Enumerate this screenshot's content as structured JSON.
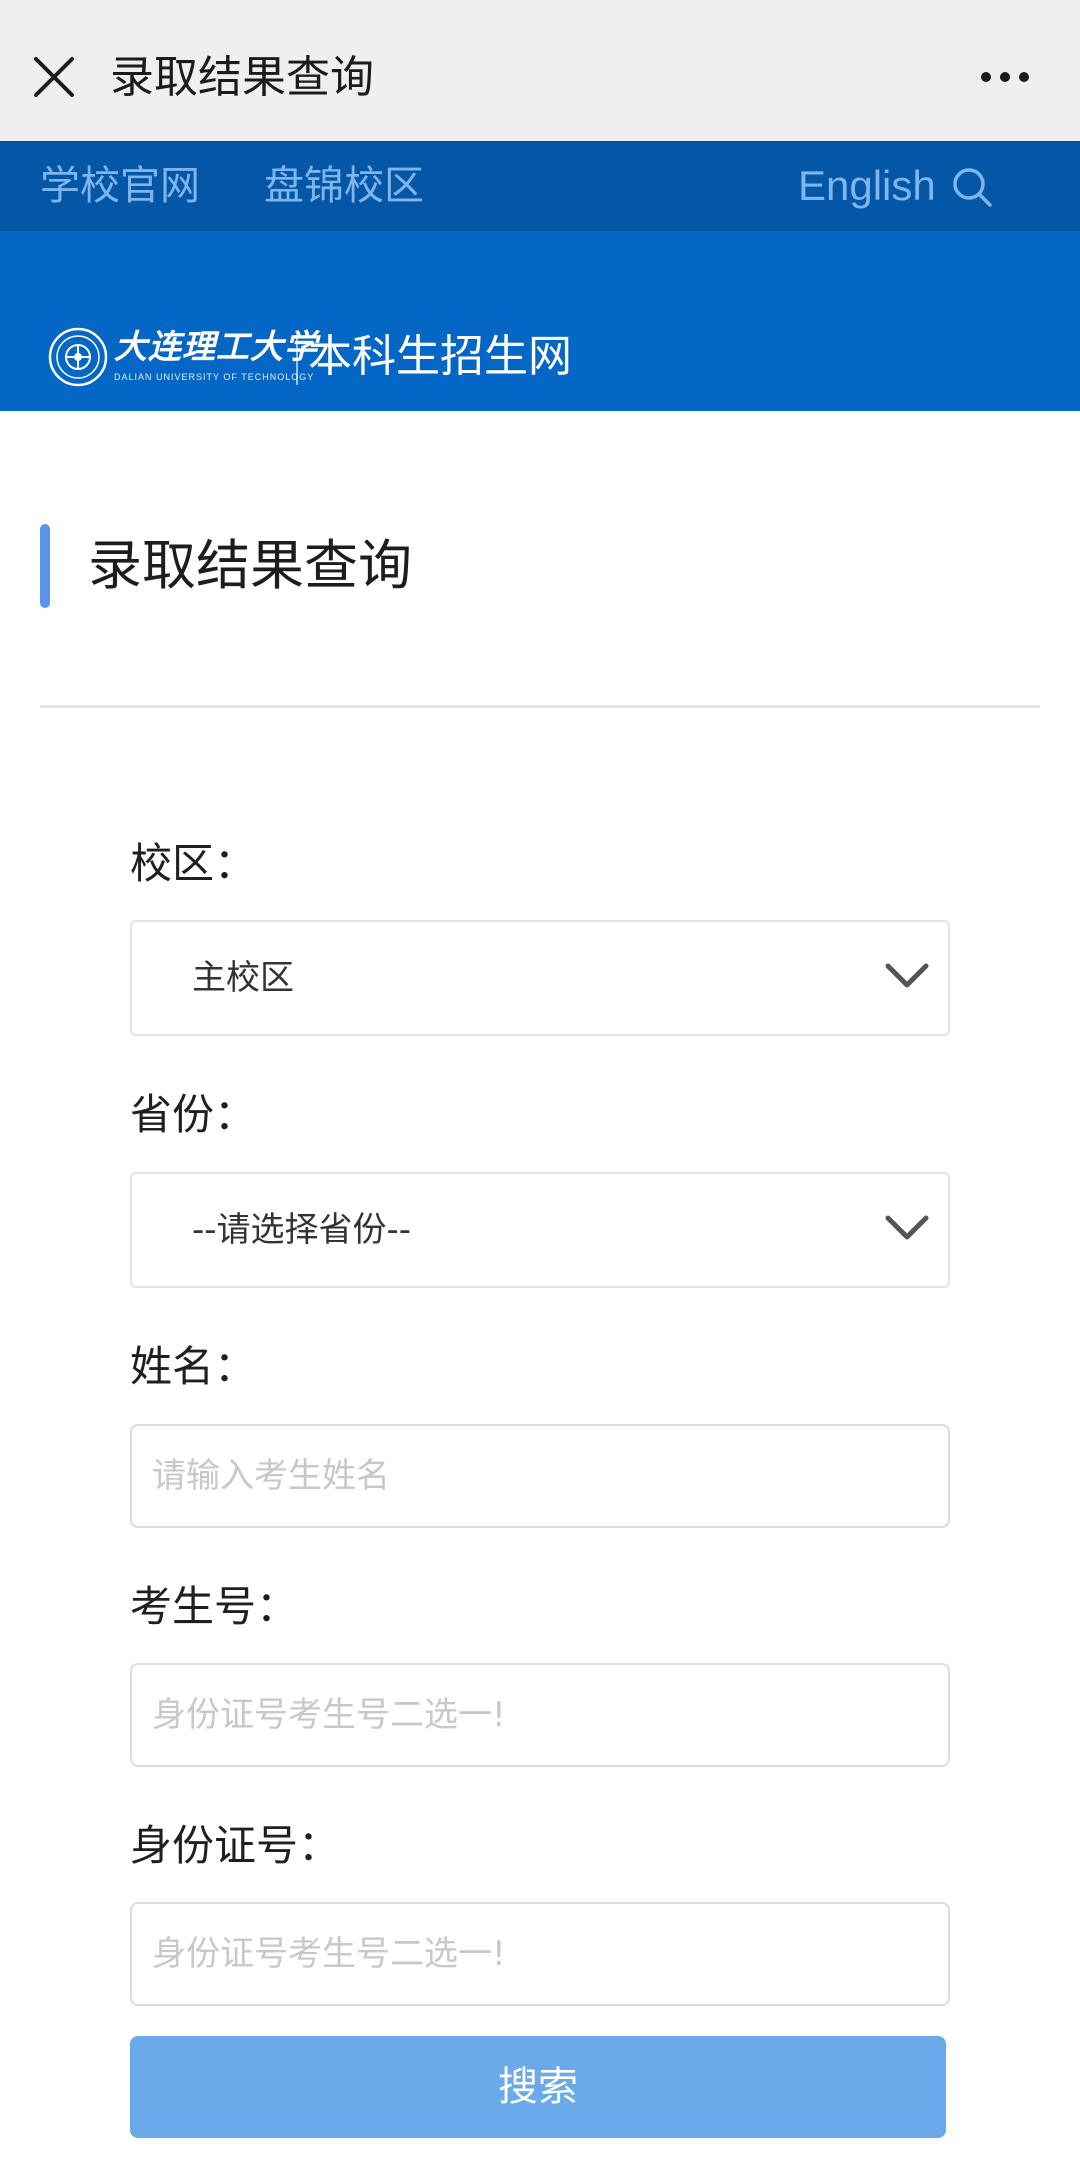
{
  "topbar": {
    "title": "录取结果查询",
    "close_icon": "close-icon",
    "more_icon": "more-icon"
  },
  "nav": {
    "official_site": "学校官网",
    "panjin_campus": "盘锦校区",
    "english": "English",
    "search_icon": "search-icon"
  },
  "banner": {
    "logo_cn": "大连理工大学",
    "logo_en": "DALIAN UNIVERSITY OF TECHNOLOGY",
    "site_name": "本科生招生网"
  },
  "section": {
    "heading": "录取结果查询"
  },
  "form": {
    "campus_label": "校区：",
    "campus_value": "主校区",
    "province_label": "省份：",
    "province_value": "--请选择省份--",
    "name_label": "姓名：",
    "name_placeholder": "请输入考生姓名",
    "exam_no_label": "考生号：",
    "exam_no_placeholder": "身份证号考生号二选一!",
    "id_no_label": "身份证号：",
    "id_no_placeholder": "身份证号考生号二选一!",
    "search_label": "搜索"
  },
  "colors": {
    "nav_bg": "#0457a6",
    "banner_bg": "#0567c5",
    "accent": "#5b93e8",
    "button": "#6aa9ea"
  }
}
